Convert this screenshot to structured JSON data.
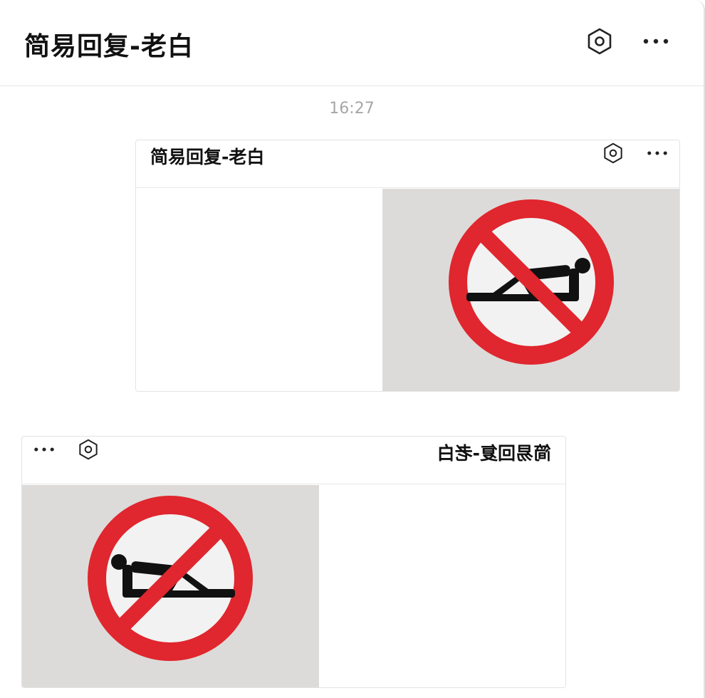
{
  "app": {
    "title": "简易回复-老白",
    "timestamp": "16:27"
  },
  "header_icons": {
    "settings": "hexagon-settings-icon",
    "more": "more-horizontal-icon"
  },
  "messages": [
    {
      "sender_side": "right",
      "card_title": "简易回复-老白",
      "image": "no-lying-down-sign",
      "colors": {
        "ring": "#e0262e",
        "figure": "#111111",
        "background": "#dcdbd9"
      }
    },
    {
      "sender_side": "left",
      "card_title": "简易回复-老白",
      "mirrored": true,
      "image": "no-lying-down-sign",
      "colors": {
        "ring": "#e0262e",
        "figure": "#111111",
        "background": "#dcdbd9"
      }
    }
  ]
}
